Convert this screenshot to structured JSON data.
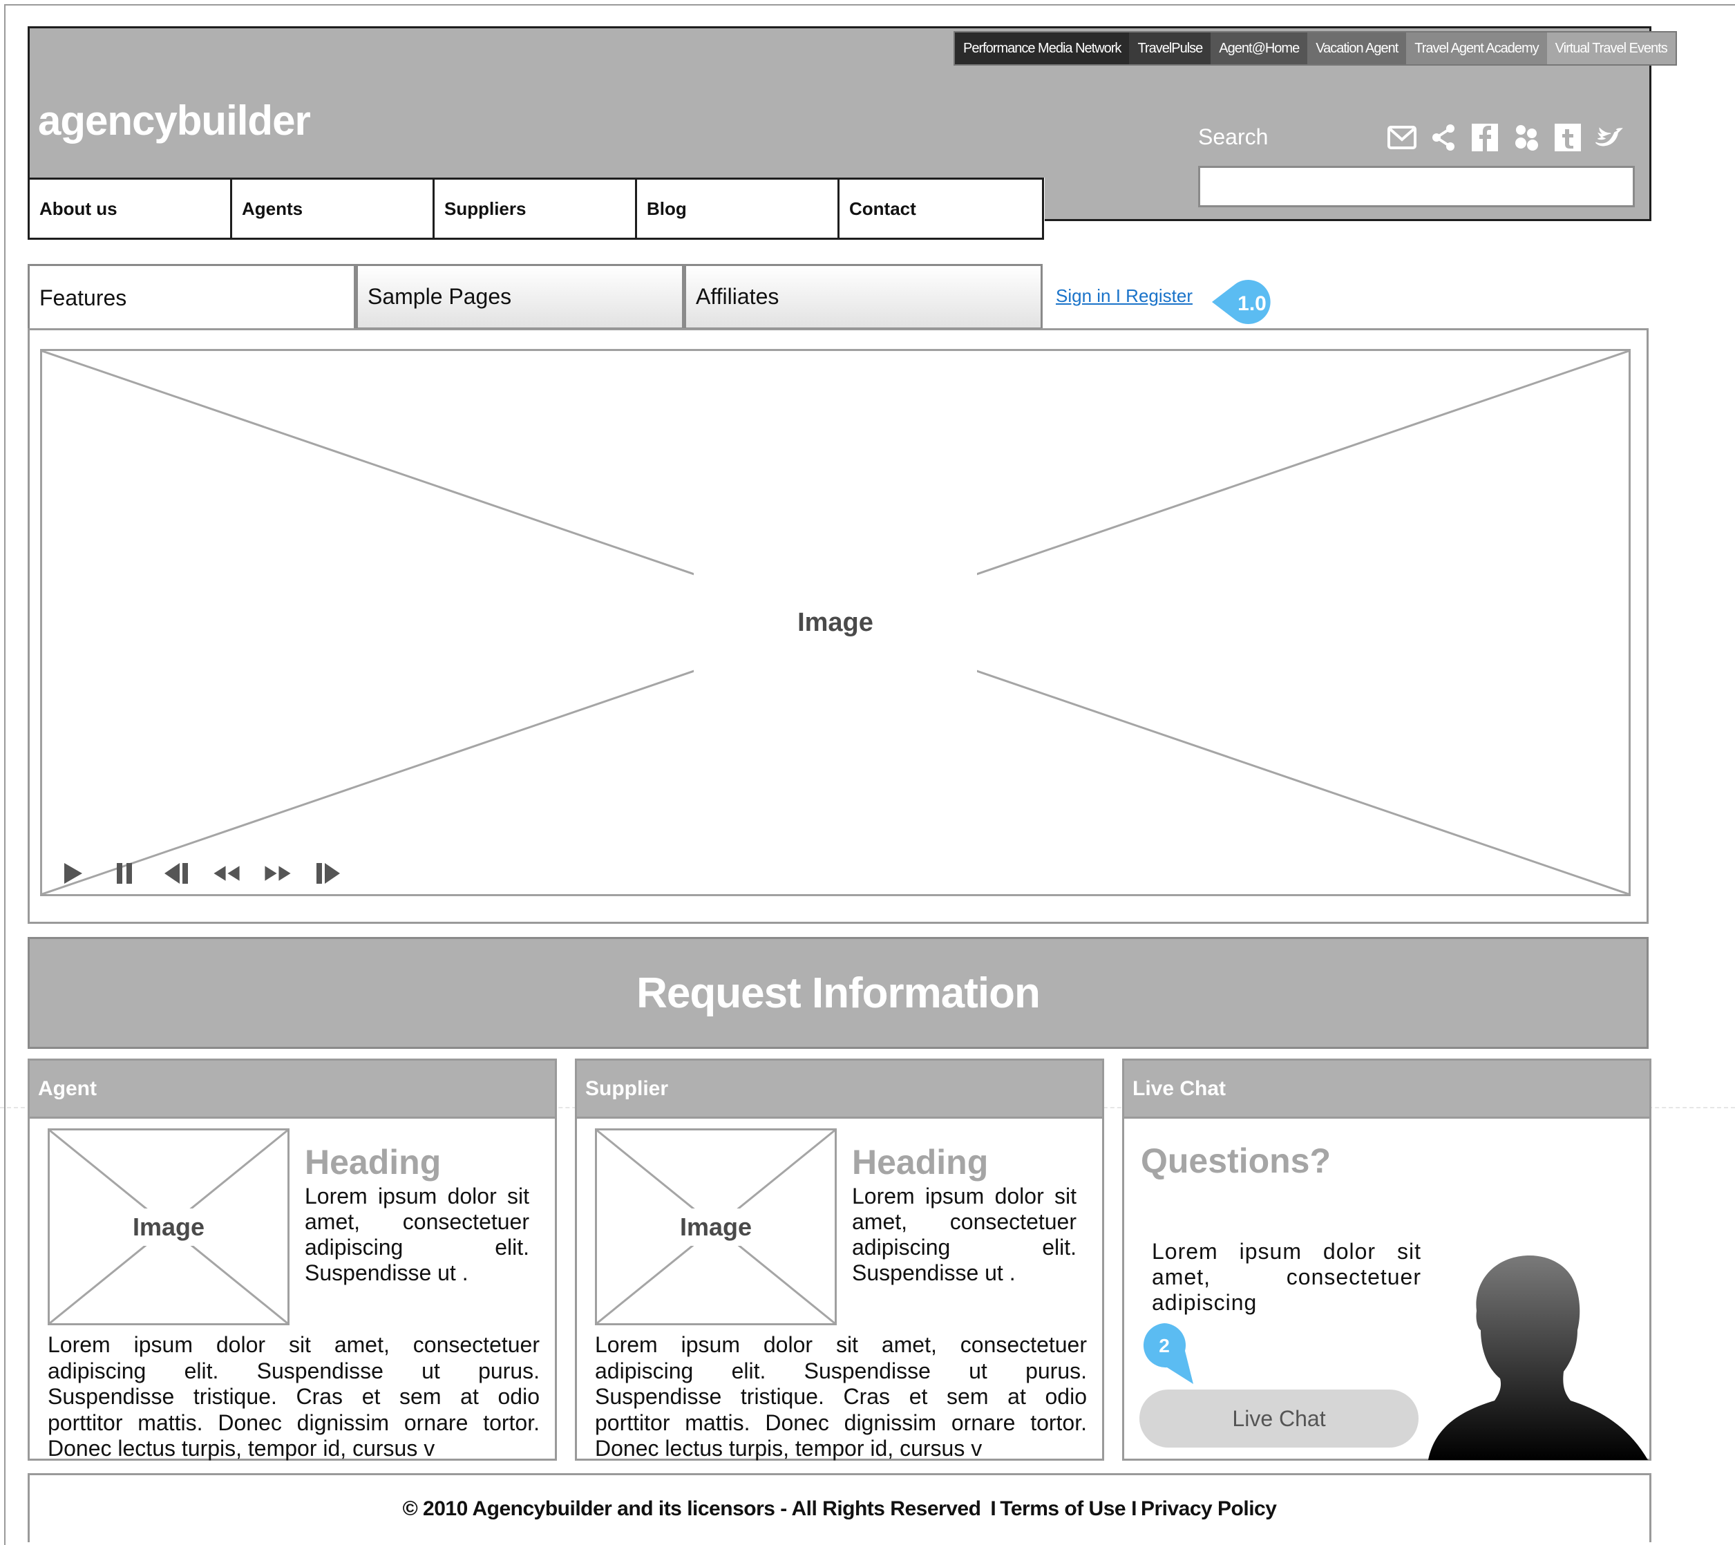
{
  "brand": {
    "logo": "agencybuilder"
  },
  "network_links": [
    {
      "label": "Performance Media Network",
      "bg": "#2a2a2a"
    },
    {
      "label": "TravelPulse",
      "bg": "#3b3b3b"
    },
    {
      "label": "Agent@Home",
      "bg": "#555555"
    },
    {
      "label": "Vacation Agent",
      "bg": "#6e6e6e"
    },
    {
      "label": "Travel Agent Academy",
      "bg": "#8a8a8a"
    },
    {
      "label": "Virtual Travel Events",
      "bg": "#a7a7a7"
    }
  ],
  "search": {
    "label": "Search",
    "placeholder": ""
  },
  "social_icons": [
    "email-icon",
    "share-icon",
    "facebook-icon",
    "delicious-icon",
    "tumblr-icon",
    "twitter-icon"
  ],
  "nav": {
    "items": [
      "About us",
      "Agents",
      "Suppliers",
      "Blog",
      "Contact"
    ]
  },
  "tabs": [
    {
      "label": "Features",
      "active": true
    },
    {
      "label": "Sample Pages",
      "active": false
    },
    {
      "label": "Affiliates",
      "active": false
    }
  ],
  "signin": {
    "label": "Sign in I Register"
  },
  "annotations": {
    "version": "1.0",
    "chat_note": "2"
  },
  "slider": {
    "image_label": "Image",
    "controls": [
      "play-icon",
      "pause-icon",
      "step-back-icon",
      "rewind-icon",
      "fast-forward-icon",
      "step-forward-icon"
    ]
  },
  "request": {
    "title": "Request Information"
  },
  "cards": [
    {
      "header": "Agent",
      "image_label": "Image",
      "heading": "Heading",
      "short_text": "Lorem ipsum dolor sit amet, consectetuer adipiscing elit. Suspendisse ut .",
      "long_text": "Lorem ipsum dolor sit amet, consectetuer adipiscing elit. Suspendisse ut purus. Suspendisse tristique. Cras et sem at odio porttitor mattis. Donec dignissim ornare tortor. Donec lectus turpis, tempor id, cursus v"
    },
    {
      "header": "Supplier",
      "image_label": "Image",
      "heading": "Heading",
      "short_text": "Lorem ipsum dolor sit amet, consectetuer adipiscing elit. Suspendisse ut .",
      "long_text": "Lorem ipsum dolor sit amet, consectetuer adipiscing elit. Suspendisse ut purus. Suspendisse tristique. Cras et sem at odio porttitor mattis. Donec dignissim ornare tortor. Donec lectus turpis, tempor id, cursus v"
    }
  ],
  "live_chat": {
    "header": "Live Chat",
    "heading": "Questions?",
    "text": "Lorem ipsum dolor sit amet, consectetuer adipiscing",
    "button": "Live Chat"
  },
  "footer": {
    "copyright": "© 2010 Agencybuilder and its licensors - All Rights Reserved",
    "sep1": "I",
    "terms": "Terms of Use",
    "sep2": "I",
    "privacy": "Privacy Policy"
  },
  "colors": {
    "header_gray": "#b0b0b0",
    "link_blue": "#1a73c9",
    "annotation_blue": "#5bbcf2"
  }
}
